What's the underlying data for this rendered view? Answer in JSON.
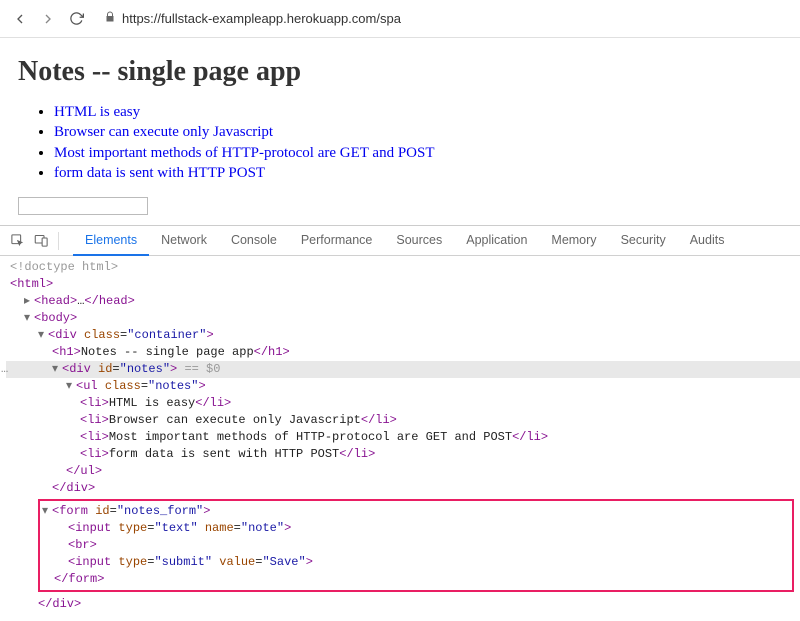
{
  "browser": {
    "url_display": "https://fullstack-exampleapp.herokuapp.com/spa"
  },
  "page": {
    "heading": "Notes -- single page app",
    "notes": [
      "HTML is easy",
      "Browser can execute only Javascript",
      "Most important methods of HTTP-protocol are GET and POST",
      "form data is sent with HTTP POST"
    ]
  },
  "devtools": {
    "tabs": [
      "Elements",
      "Network",
      "Console",
      "Performance",
      "Sources",
      "Application",
      "Memory",
      "Security",
      "Audits"
    ],
    "active_tab": "Elements"
  },
  "dom": {
    "doctype": "<!doctype html>",
    "html_open": "html",
    "head": {
      "open": "head",
      "dots": "…",
      "close": "/head"
    },
    "body_open": "body",
    "container": {
      "tag": "div",
      "attr_class": "class",
      "class_val": "\"container\""
    },
    "h1": {
      "open": "h1",
      "text": "Notes -- single page app",
      "close": "/h1"
    },
    "notes_div": {
      "tag": "div",
      "attr_id": "id",
      "id_val": "\"notes\"",
      "hint": " == $0"
    },
    "ul": {
      "tag": "ul",
      "attr_class": "class",
      "class_val": "\"notes\""
    },
    "li": [
      "HTML is easy",
      "Browser can execute only Javascript",
      "Most important methods of HTTP-protocol are GET and POST",
      "form data is sent with HTTP POST"
    ],
    "ul_close": "/ul",
    "div_close": "/div",
    "form": {
      "open": {
        "tag": "form",
        "attr_id": "id",
        "id_val": "\"notes_form\""
      },
      "input1": {
        "tag": "input",
        "attr1": "type",
        "val1": "\"text\"",
        "attr2": "name",
        "val2": "\"note\""
      },
      "br": "br",
      "input2": {
        "tag": "input",
        "attr1": "type",
        "val1": "\"submit\"",
        "attr2": "value",
        "val2": "\"Save\""
      },
      "close": "/form"
    },
    "container_close": "/div"
  }
}
